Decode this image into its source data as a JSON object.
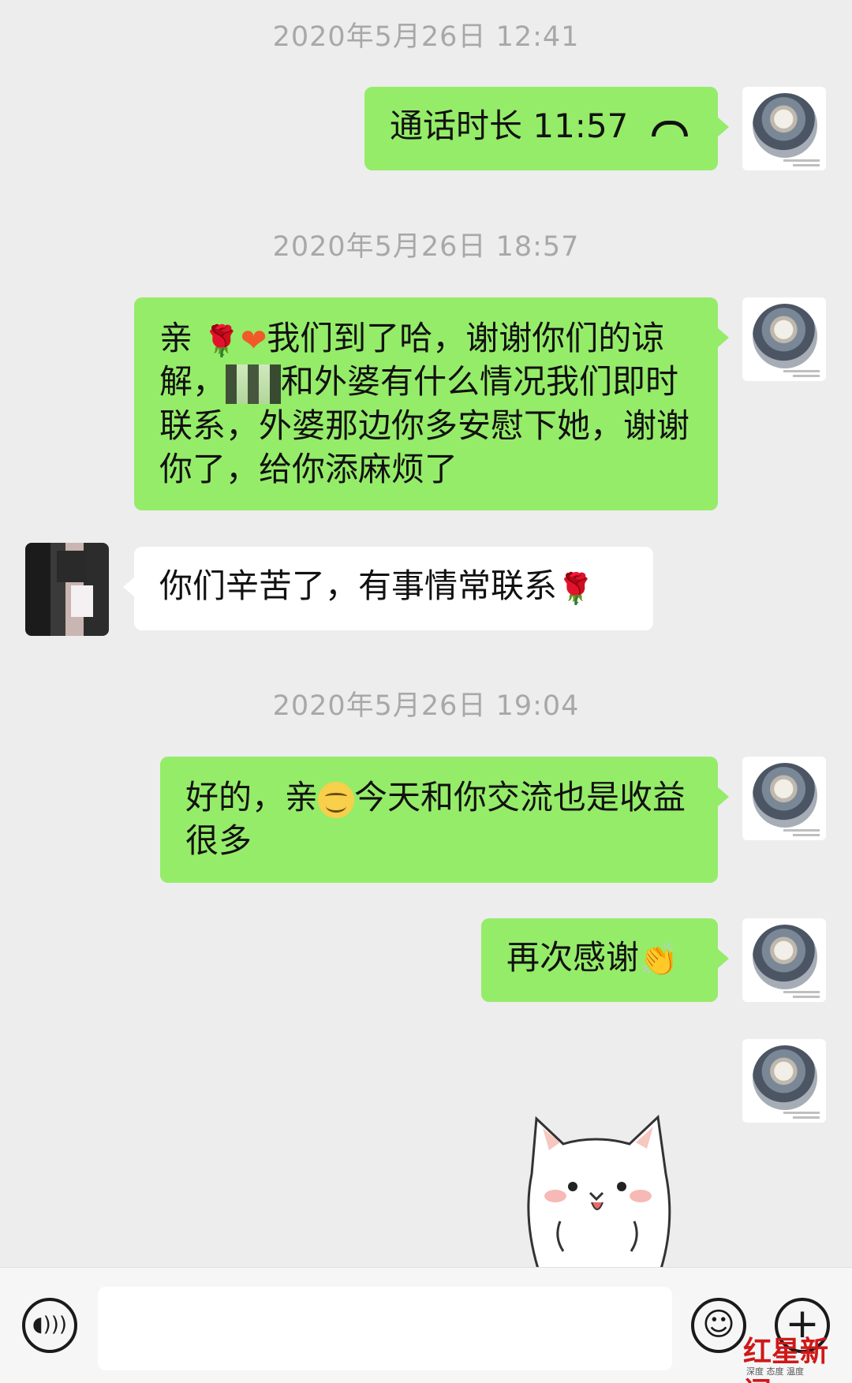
{
  "timestamps": {
    "t1": "2020年5月26日 12:41",
    "t2": "2020年5月26日 18:57",
    "t3": "2020年5月26日 19:04"
  },
  "messages": {
    "call": "通话时长 11:57",
    "msg2_a": "亲",
    "msg2_b": "我们到了哈，谢谢你们的谅解，",
    "msg2_c": "和外婆有什么情况我们即时联系，外婆那边你多安慰下她，谢谢你了，给你添麻烦了",
    "msg3": "你们辛苦了，有事情常联系",
    "msg4_a": "好的，亲",
    "msg4_b": "今天和你交流也是收益很多",
    "msg5": "再次感谢"
  },
  "icons": {
    "call": "phone-hangup-icon",
    "rose": "rose-emoji",
    "heart": "heart-emoji",
    "smile": "smile-emoji",
    "hands": "clap-hands-emoji",
    "voice": "voice-icon",
    "emoji": "emoji-icon",
    "plus": "plus-icon"
  },
  "watermark": {
    "brand": "红星新闻",
    "tagline": "深度 态度 温度"
  },
  "colors": {
    "background": "#ededed",
    "my_bubble": "#95ec69",
    "their_bubble": "#ffffff",
    "timestamp": "#a8a8a8"
  }
}
